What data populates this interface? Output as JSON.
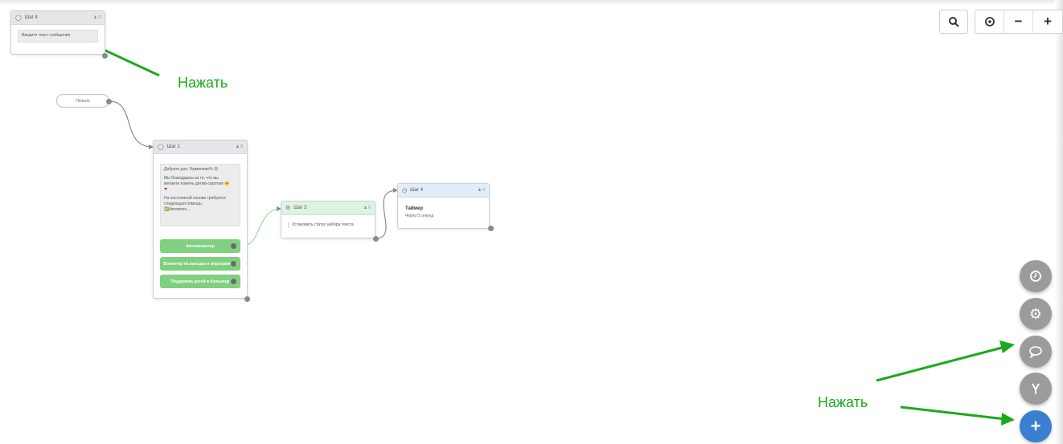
{
  "start_node": {
    "label": "Начало"
  },
  "nodes": [
    {
      "id": "step4-top",
      "title": "Шаг 4",
      "count": "0",
      "message": "Введите текст сообщения"
    },
    {
      "id": "step1",
      "title": "Шаг 1",
      "count": "0",
      "message_lines": [
        "Доброго дня, %имяпапе% 😊",
        "",
        "Мы благодарны за то, что вы",
        "желаете помочь детям-сиротам 🤗",
        "❤",
        "",
        "На постоянной основе требуется",
        "следующая помощь:",
        "✅Автоволо..."
      ],
      "buttons": [
        "Автоволонтер",
        "Волонтер на выезды и мероприятия",
        "Поддержка детей в больнице"
      ]
    },
    {
      "id": "step3",
      "title": "Шаг 3",
      "count": "0",
      "action": "Установить статус набора текста"
    },
    {
      "id": "step4-timer",
      "title": "Шаг 4",
      "count": "0",
      "heading": "Таймер",
      "subtext": "Через 5 секунд"
    }
  ],
  "zoom_controls": {
    "search": "search-icon",
    "center": "target-icon",
    "zoom_out": "−",
    "zoom_in": "+"
  },
  "fab_buttons": [
    {
      "name": "timer-fab",
      "icon": "clock-icon"
    },
    {
      "name": "action-fab",
      "icon": "gears-icon"
    },
    {
      "name": "message-fab",
      "icon": "chat-bubble-icon"
    },
    {
      "name": "split-fab",
      "icon": "branch-icon"
    },
    {
      "name": "add-fab",
      "icon": "plus-icon",
      "symbol": "+"
    }
  ],
  "annotations": [
    {
      "text": "Нажать"
    },
    {
      "text": "Нажать"
    }
  ],
  "colors": {
    "annotation": "#1aab1a",
    "button_green": "#7fd07f",
    "fab_grey": "#9b9b9b",
    "fab_blue": "#3a7fd1"
  }
}
